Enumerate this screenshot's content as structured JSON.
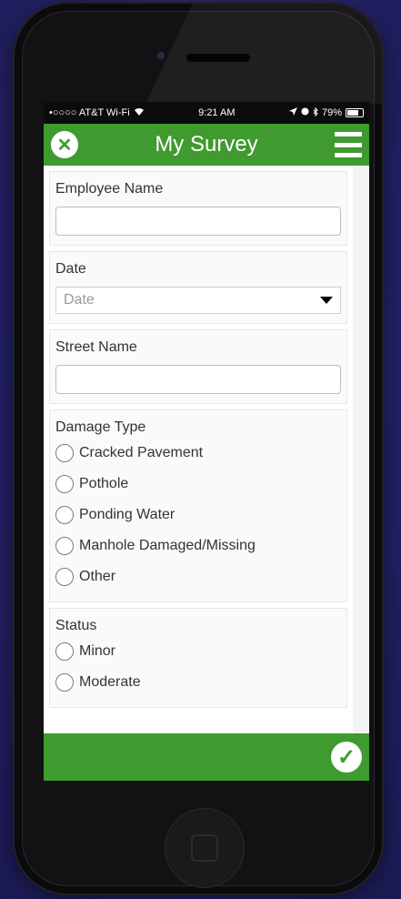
{
  "status_bar": {
    "carrier": "•○○○○ AT&T Wi-Fi",
    "wifi_icon": "wifi-icon",
    "time": "9:21 AM",
    "battery": "79%"
  },
  "header": {
    "title": "My Survey",
    "close_icon": "close-icon",
    "menu_icon": "hamburger-menu-icon",
    "accent_color": "#3f9a2f"
  },
  "form": {
    "employee_name": {
      "label": "Employee Name",
      "value": ""
    },
    "date": {
      "label": "Date",
      "placeholder": "Date"
    },
    "street_name": {
      "label": "Street Name",
      "value": ""
    },
    "damage_type": {
      "label": "Damage Type",
      "options": [
        "Cracked Pavement",
        "Pothole",
        "Ponding Water",
        "Manhole Damaged/Missing",
        "Other"
      ]
    },
    "status": {
      "label": "Status",
      "options": [
        "Minor",
        "Moderate"
      ]
    }
  },
  "footer": {
    "submit_icon": "checkmark-icon"
  }
}
